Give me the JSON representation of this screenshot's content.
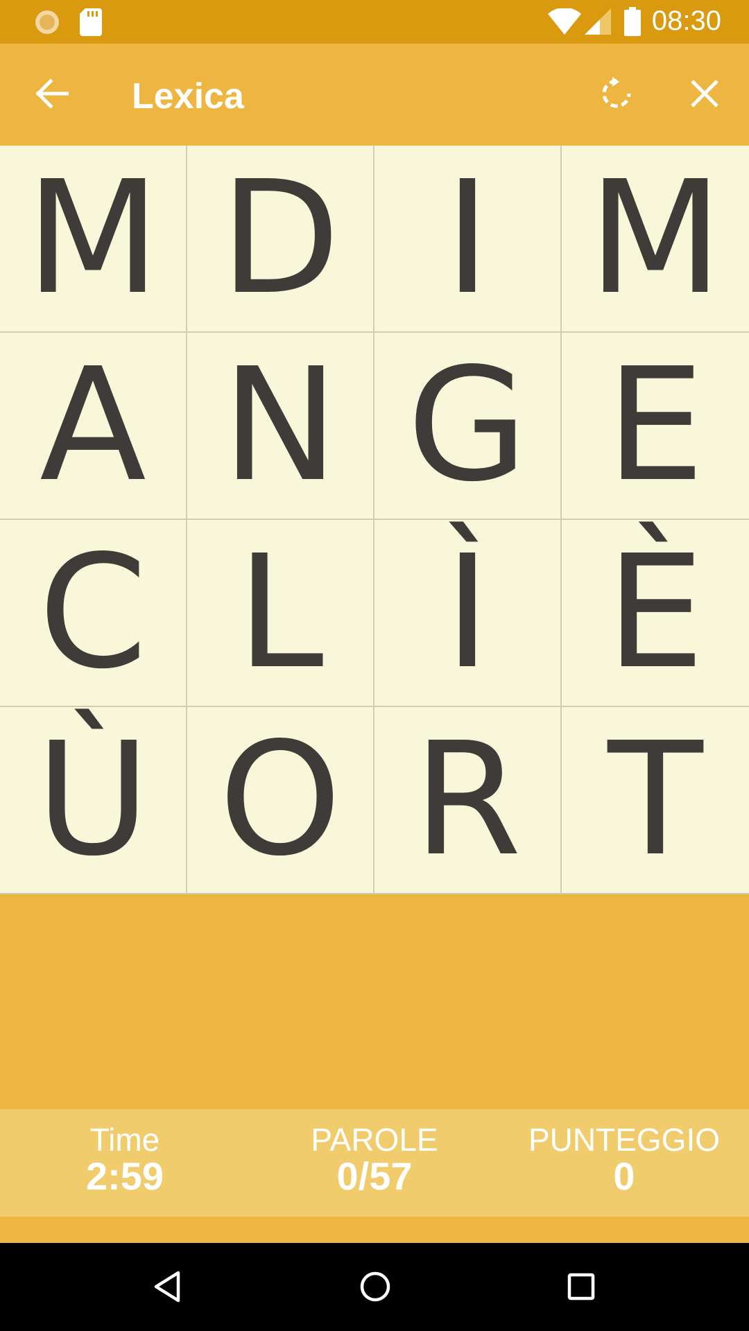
{
  "status_bar": {
    "time": "08:30",
    "icons": [
      "notification-sun-icon",
      "sd-card-icon",
      "wifi-icon",
      "signal-icon",
      "battery-icon"
    ]
  },
  "app_bar": {
    "title": "Lexica",
    "back_icon": "arrow-left-icon",
    "restart_icon": "rotate-icon",
    "close_icon": "close-icon"
  },
  "board": {
    "rows": [
      [
        "M",
        "D",
        "I",
        "M"
      ],
      [
        "A",
        "N",
        "G",
        "E"
      ],
      [
        "C",
        "L",
        "Ì",
        "È"
      ],
      [
        "Ù",
        "O",
        "R",
        "T"
      ]
    ]
  },
  "stats": {
    "time_label": "Time",
    "time_value": "2:59",
    "words_label": "PAROLE",
    "words_value": "0/57",
    "score_label": "PUNTEGGIO",
    "score_value": "0"
  },
  "nav_bar": {
    "icons": [
      "back-triangle-icon",
      "home-circle-icon",
      "recents-square-icon"
    ]
  },
  "colors": {
    "status_bar": "#D99A10",
    "accent": "#EDB641",
    "board_bg": "#F8F7D9",
    "score_bar": "#F0CC6D",
    "letter": "#3E3C38"
  }
}
